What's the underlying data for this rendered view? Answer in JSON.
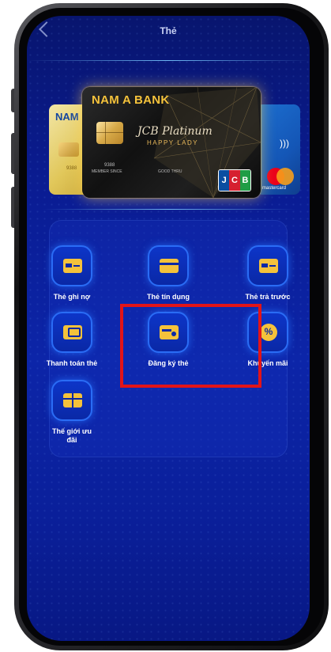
{
  "header": {
    "title": "Thẻ"
  },
  "cards": {
    "main": {
      "bank": "NAM A BANK",
      "product": "JCB Platinum",
      "tagline": "HAPPY LADY",
      "network": "JCB",
      "number_fragment": "9388",
      "member_since": "MEMBER SINCE",
      "good_thru": "GOOD THRU"
    },
    "left": {
      "bank": "NAM",
      "number_fragment": "9388"
    },
    "right": {
      "network": "mastercard"
    }
  },
  "menu": [
    {
      "label": "Thẻ ghi nợ",
      "icon": "debit-card-icon"
    },
    {
      "label": "Thẻ tín dụng",
      "icon": "credit-card-icon"
    },
    {
      "label": "Thẻ trả trước",
      "icon": "prepaid-card-icon"
    },
    {
      "label": "Thanh toán thẻ",
      "icon": "card-payment-icon"
    },
    {
      "label": "Đăng ký thẻ",
      "icon": "card-register-icon"
    },
    {
      "label": "Khuyến mãi",
      "icon": "promotion-icon"
    },
    {
      "label": "Thế giới ưu đãi",
      "icon": "gift-icon"
    }
  ],
  "colors": {
    "accent": "#f4c23b",
    "highlight": "#e21418",
    "background": "#0a1c93"
  }
}
